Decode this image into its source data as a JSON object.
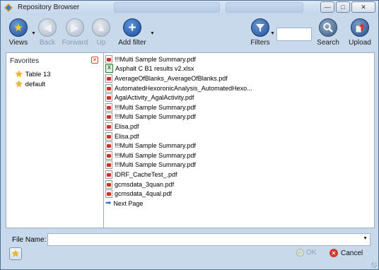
{
  "window": {
    "title": "Repository Browser",
    "controls": {
      "minimize": "—",
      "maximize": "□",
      "close": "✕"
    }
  },
  "toolbar": {
    "views_label": "Views",
    "back_label": "Back",
    "forward_label": "Forward",
    "up_label": "Up",
    "add_filter_label": "Add filter",
    "filters_label": "Filters",
    "search_label": "Search",
    "upload_label": "Upload",
    "filter_value": ""
  },
  "favorites": {
    "header": "Favorites",
    "items": [
      {
        "label": "Table 13"
      },
      {
        "label": "default"
      }
    ]
  },
  "files": [
    {
      "name": "!!!Multi Sample Summary.pdf",
      "type": "pdf"
    },
    {
      "name": "Asphalt C B1 results v2.xlsx",
      "type": "xlsx"
    },
    {
      "name": "AverageOfBlanks_AverageOfBlanks.pdf",
      "type": "pdf"
    },
    {
      "name": "AutomatedHexoronicAnalysis_AutomatedHexo...",
      "type": "pdf"
    },
    {
      "name": "AgalActivity_AgalActivity.pdf",
      "type": "pdf"
    },
    {
      "name": "!!!Multi Sample Summary.pdf",
      "type": "pdf"
    },
    {
      "name": "!!!Multi Sample Summary.pdf",
      "type": "pdf"
    },
    {
      "name": "Elisa.pdf",
      "type": "pdf"
    },
    {
      "name": "Elisa.pdf",
      "type": "pdf"
    },
    {
      "name": "!!!Multi Sample Summary.pdf",
      "type": "pdf"
    },
    {
      "name": "!!!Multi Sample Summary.pdf",
      "type": "pdf"
    },
    {
      "name": "!!!Multi Sample Summary.pdf",
      "type": "pdf"
    },
    {
      "name": "IDRF_CacheTest_.pdf",
      "type": "pdf"
    },
    {
      "name": "gcmsdata_3quan.pdf",
      "type": "pdf"
    },
    {
      "name": "gcmsdata_4qual.pdf",
      "type": "pdf"
    },
    {
      "name": "Next Page",
      "type": "next"
    }
  ],
  "footer": {
    "file_name_label": "File Name:",
    "file_name_value": "",
    "ok_label": "OK",
    "cancel_label": "Cancel"
  },
  "colors": {
    "window_bg": "#c9d9ec",
    "accent_blue": "#2a6fcf",
    "cancel_red": "#d33a2a",
    "star_gold": "#f2b90c"
  }
}
